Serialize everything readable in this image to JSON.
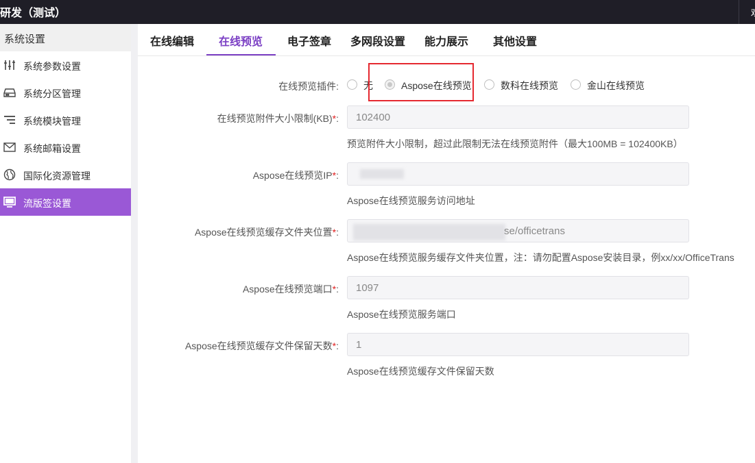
{
  "window": {
    "title": "研发（测试）",
    "user_initial": "欢"
  },
  "sidebar": {
    "header": "系统设置",
    "items": [
      {
        "label": "系统参数设置",
        "icon": "sliders-icon",
        "active": false
      },
      {
        "label": "系统分区管理",
        "icon": "storage-icon",
        "active": false
      },
      {
        "label": "系统模块管理",
        "icon": "list-icon",
        "active": false
      },
      {
        "label": "系统邮箱设置",
        "icon": "mail-icon",
        "active": false
      },
      {
        "label": "国际化资源管理",
        "icon": "globe-icon",
        "active": false
      },
      {
        "label": "流版签设置",
        "icon": "monitor-icon",
        "active": true
      }
    ]
  },
  "tabs": [
    {
      "label": "在线编辑",
      "active": false
    },
    {
      "label": "在线预览",
      "active": true
    },
    {
      "label": "电子签章",
      "active": false
    },
    {
      "label": "多网段设置",
      "active": false
    },
    {
      "label": "能力展示",
      "active": false
    },
    {
      "label": "其他设置",
      "active": false
    }
  ],
  "form": {
    "plugin": {
      "label": "在线预览插件:",
      "options": [
        "无",
        "Aspose在线预览",
        "数科在线预览",
        "金山在线预览"
      ],
      "selected": "Aspose在线预览"
    },
    "size_limit": {
      "label": "在线预览附件大小限制(KB)",
      "value": "102400",
      "hint": "预览附件大小限制，超过此限制无法在线预览附件（最大100MB = 102400KB）"
    },
    "ip": {
      "label": "Aspose在线预览IP",
      "value": "",
      "hint": "Aspose在线预览服务访问地址"
    },
    "cache_folder": {
      "label": "Aspose在线预览缓存文件夹位置",
      "value": "se/officetrans",
      "hint": "Aspose在线预览服务缓存文件夹位置，注：请勿配置Aspose安装目录，例xx/xx/OfficeTrans"
    },
    "port": {
      "label": "Aspose在线预览端口",
      "value": "1097",
      "hint": "Aspose在线预览服务端口"
    },
    "cache_days": {
      "label": "Aspose在线预览缓存文件保留天数",
      "value": "1",
      "hint": "Aspose在线预览缓存文件保留天数"
    },
    "required_mark": "*",
    "label_suffix": ":"
  },
  "colors": {
    "accent": "#7b3fc4",
    "sidebar_active": "#9a58d6",
    "topbar": "#1f1e27",
    "highlight": "#e5282f"
  }
}
